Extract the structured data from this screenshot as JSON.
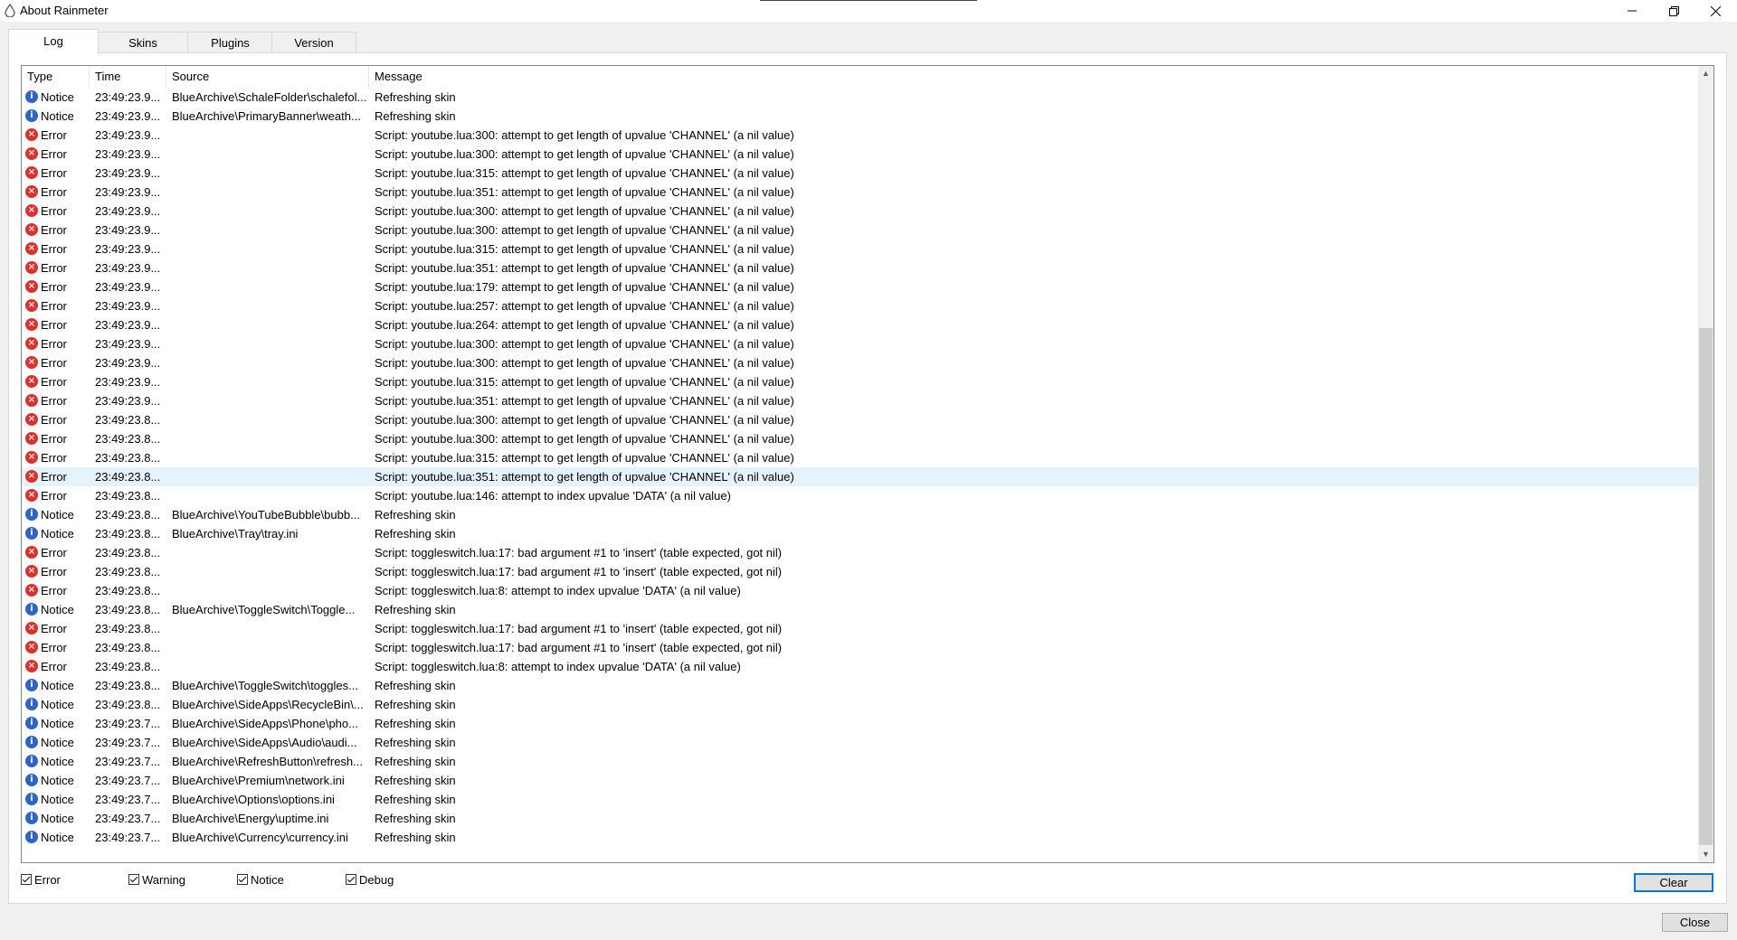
{
  "window": {
    "title": "About Rainmeter"
  },
  "tabs": [
    {
      "label": "Log"
    },
    {
      "label": "Skins"
    },
    {
      "label": "Plugins"
    },
    {
      "label": "Version"
    }
  ],
  "log": {
    "columns": {
      "type": "Type",
      "time": "Time",
      "source": "Source",
      "message": "Message"
    },
    "rows": [
      {
        "type": "Notice",
        "time": "23:49:23.9...",
        "source": "BlueArchive\\SchaleFolder\\schalefol...",
        "message": "Refreshing skin"
      },
      {
        "type": "Notice",
        "time": "23:49:23.9...",
        "source": "BlueArchive\\PrimaryBanner\\weath...",
        "message": "Refreshing skin"
      },
      {
        "type": "Error",
        "time": "23:49:23.9...",
        "source": "",
        "message": "Script: youtube.lua:300: attempt to get length of upvalue 'CHANNEL' (a nil value)"
      },
      {
        "type": "Error",
        "time": "23:49:23.9...",
        "source": "",
        "message": "Script: youtube.lua:300: attempt to get length of upvalue 'CHANNEL' (a nil value)"
      },
      {
        "type": "Error",
        "time": "23:49:23.9...",
        "source": "",
        "message": "Script: youtube.lua:315: attempt to get length of upvalue 'CHANNEL' (a nil value)"
      },
      {
        "type": "Error",
        "time": "23:49:23.9...",
        "source": "",
        "message": "Script: youtube.lua:351: attempt to get length of upvalue 'CHANNEL' (a nil value)"
      },
      {
        "type": "Error",
        "time": "23:49:23.9...",
        "source": "",
        "message": "Script: youtube.lua:300: attempt to get length of upvalue 'CHANNEL' (a nil value)"
      },
      {
        "type": "Error",
        "time": "23:49:23.9...",
        "source": "",
        "message": "Script: youtube.lua:300: attempt to get length of upvalue 'CHANNEL' (a nil value)"
      },
      {
        "type": "Error",
        "time": "23:49:23.9...",
        "source": "",
        "message": "Script: youtube.lua:315: attempt to get length of upvalue 'CHANNEL' (a nil value)"
      },
      {
        "type": "Error",
        "time": "23:49:23.9...",
        "source": "",
        "message": "Script: youtube.lua:351: attempt to get length of upvalue 'CHANNEL' (a nil value)"
      },
      {
        "type": "Error",
        "time": "23:49:23.9...",
        "source": "",
        "message": "Script: youtube.lua:179: attempt to get length of upvalue 'CHANNEL' (a nil value)"
      },
      {
        "type": "Error",
        "time": "23:49:23.9...",
        "source": "",
        "message": "Script: youtube.lua:257: attempt to get length of upvalue 'CHANNEL' (a nil value)"
      },
      {
        "type": "Error",
        "time": "23:49:23.9...",
        "source": "",
        "message": "Script: youtube.lua:264: attempt to get length of upvalue 'CHANNEL' (a nil value)"
      },
      {
        "type": "Error",
        "time": "23:49:23.9...",
        "source": "",
        "message": "Script: youtube.lua:300: attempt to get length of upvalue 'CHANNEL' (a nil value)"
      },
      {
        "type": "Error",
        "time": "23:49:23.9...",
        "source": "",
        "message": "Script: youtube.lua:300: attempt to get length of upvalue 'CHANNEL' (a nil value)"
      },
      {
        "type": "Error",
        "time": "23:49:23.9...",
        "source": "",
        "message": "Script: youtube.lua:315: attempt to get length of upvalue 'CHANNEL' (a nil value)"
      },
      {
        "type": "Error",
        "time": "23:49:23.9...",
        "source": "",
        "message": "Script: youtube.lua:351: attempt to get length of upvalue 'CHANNEL' (a nil value)"
      },
      {
        "type": "Error",
        "time": "23:49:23.8...",
        "source": "",
        "message": "Script: youtube.lua:300: attempt to get length of upvalue 'CHANNEL' (a nil value)"
      },
      {
        "type": "Error",
        "time": "23:49:23.8...",
        "source": "",
        "message": "Script: youtube.lua:300: attempt to get length of upvalue 'CHANNEL' (a nil value)"
      },
      {
        "type": "Error",
        "time": "23:49:23.8...",
        "source": "",
        "message": "Script: youtube.lua:315: attempt to get length of upvalue 'CHANNEL' (a nil value)"
      },
      {
        "type": "Error",
        "time": "23:49:23.8...",
        "source": "",
        "message": "Script: youtube.lua:351: attempt to get length of upvalue 'CHANNEL' (a nil value)",
        "selected": true
      },
      {
        "type": "Error",
        "time": "23:49:23.8...",
        "source": "",
        "message": "Script: youtube.lua:146: attempt to index upvalue 'DATA' (a nil value)"
      },
      {
        "type": "Notice",
        "time": "23:49:23.8...",
        "source": "BlueArchive\\YouTubeBubble\\bubb...",
        "message": "Refreshing skin"
      },
      {
        "type": "Notice",
        "time": "23:49:23.8...",
        "source": "BlueArchive\\Tray\\tray.ini",
        "message": "Refreshing skin"
      },
      {
        "type": "Error",
        "time": "23:49:23.8...",
        "source": "",
        "message": "Script: toggleswitch.lua:17: bad argument #1 to 'insert' (table expected, got nil)"
      },
      {
        "type": "Error",
        "time": "23:49:23.8...",
        "source": "",
        "message": "Script: toggleswitch.lua:17: bad argument #1 to 'insert' (table expected, got nil)"
      },
      {
        "type": "Error",
        "time": "23:49:23.8...",
        "source": "",
        "message": "Script: toggleswitch.lua:8: attempt to index upvalue 'DATA' (a nil value)"
      },
      {
        "type": "Notice",
        "time": "23:49:23.8...",
        "source": "BlueArchive\\ToggleSwitch\\Toggle...",
        "message": "Refreshing skin"
      },
      {
        "type": "Error",
        "time": "23:49:23.8...",
        "source": "",
        "message": "Script: toggleswitch.lua:17: bad argument #1 to 'insert' (table expected, got nil)"
      },
      {
        "type": "Error",
        "time": "23:49:23.8...",
        "source": "",
        "message": "Script: toggleswitch.lua:17: bad argument #1 to 'insert' (table expected, got nil)"
      },
      {
        "type": "Error",
        "time": "23:49:23.8...",
        "source": "",
        "message": "Script: toggleswitch.lua:8: attempt to index upvalue 'DATA' (a nil value)"
      },
      {
        "type": "Notice",
        "time": "23:49:23.8...",
        "source": "BlueArchive\\ToggleSwitch\\toggles...",
        "message": "Refreshing skin"
      },
      {
        "type": "Notice",
        "time": "23:49:23.8...",
        "source": "BlueArchive\\SideApps\\RecycleBin\\...",
        "message": "Refreshing skin"
      },
      {
        "type": "Notice",
        "time": "23:49:23.7...",
        "source": "BlueArchive\\SideApps\\Phone\\pho...",
        "message": "Refreshing skin"
      },
      {
        "type": "Notice",
        "time": "23:49:23.7...",
        "source": "BlueArchive\\SideApps\\Audio\\audi...",
        "message": "Refreshing skin"
      },
      {
        "type": "Notice",
        "time": "23:49:23.7...",
        "source": "BlueArchive\\RefreshButton\\refresh...",
        "message": "Refreshing skin"
      },
      {
        "type": "Notice",
        "time": "23:49:23.7...",
        "source": "BlueArchive\\Premium\\network.ini",
        "message": "Refreshing skin"
      },
      {
        "type": "Notice",
        "time": "23:49:23.7...",
        "source": "BlueArchive\\Options\\options.ini",
        "message": "Refreshing skin"
      },
      {
        "type": "Notice",
        "time": "23:49:23.7...",
        "source": "BlueArchive\\Energy\\uptime.ini",
        "message": "Refreshing skin"
      },
      {
        "type": "Notice",
        "time": "23:49:23.7...",
        "source": "BlueArchive\\Currency\\currency.ini",
        "message": "Refreshing skin"
      }
    ]
  },
  "filters": [
    {
      "label": "Error",
      "checked": true
    },
    {
      "label": "Warning",
      "checked": true
    },
    {
      "label": "Notice",
      "checked": true
    },
    {
      "label": "Debug",
      "checked": true
    }
  ],
  "buttons": {
    "clear": "Clear",
    "close": "Close"
  },
  "colors": {
    "notice_icon": "#2e64c8",
    "error_icon": "#d9322f",
    "selected_row": "#e5f3ff",
    "focus_border": "#0078d7"
  },
  "icons": {
    "app": "rainmeter-drop-icon",
    "notice": "info-icon",
    "error": "error-x-icon"
  }
}
